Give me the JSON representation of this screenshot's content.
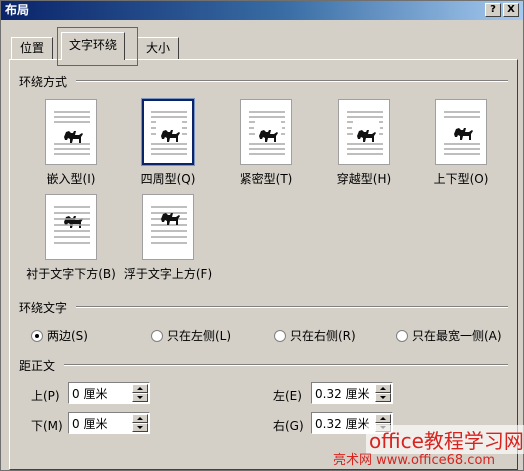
{
  "window": {
    "title": "布局",
    "help_label": "?",
    "close_label": "X"
  },
  "tabs": [
    {
      "label": "位置",
      "active": false
    },
    {
      "label": "文字环绕",
      "active": true
    },
    {
      "label": "大小",
      "active": false
    }
  ],
  "wrap_style": {
    "group_label": "环绕方式",
    "options": [
      {
        "label": "嵌入型(I)",
        "icon": "inline-wrap-icon",
        "selected": false
      },
      {
        "label": "四周型(Q)",
        "icon": "square-wrap-icon",
        "selected": true
      },
      {
        "label": "紧密型(T)",
        "icon": "tight-wrap-icon",
        "selected": false
      },
      {
        "label": "穿越型(H)",
        "icon": "through-wrap-icon",
        "selected": false
      },
      {
        "label": "上下型(O)",
        "icon": "top-bottom-wrap-icon",
        "selected": false
      },
      {
        "label": "衬于文字下方(B)",
        "icon": "behind-text-icon",
        "selected": false
      },
      {
        "label": "浮于文字上方(F)",
        "icon": "in-front-text-icon",
        "selected": false
      }
    ]
  },
  "wrap_text": {
    "group_label": "环绕文字",
    "options": [
      {
        "label": "两边(S)",
        "selected": true
      },
      {
        "label": "只在左侧(L)",
        "selected": false
      },
      {
        "label": "只在右侧(R)",
        "selected": false
      },
      {
        "label": "只在最宽一侧(A)",
        "selected": false
      }
    ]
  },
  "distance": {
    "group_label": "距正文",
    "top": {
      "label": "上(P)",
      "value": "0 厘米"
    },
    "bottom": {
      "label": "下(M)",
      "value": "0 厘米"
    },
    "left": {
      "label": "左(E)",
      "value": "0.32 厘米"
    },
    "right": {
      "label": "右(G)",
      "value": "0.32 厘米"
    }
  },
  "watermark": {
    "line1": "office教程学习网",
    "line2": "亮术网 www.office68.com"
  },
  "colors": {
    "dialog_bg": "#d4d0c8",
    "title_bar": "#0a246a",
    "highlight_box": "#e03030",
    "watermark": "#d8231e"
  }
}
